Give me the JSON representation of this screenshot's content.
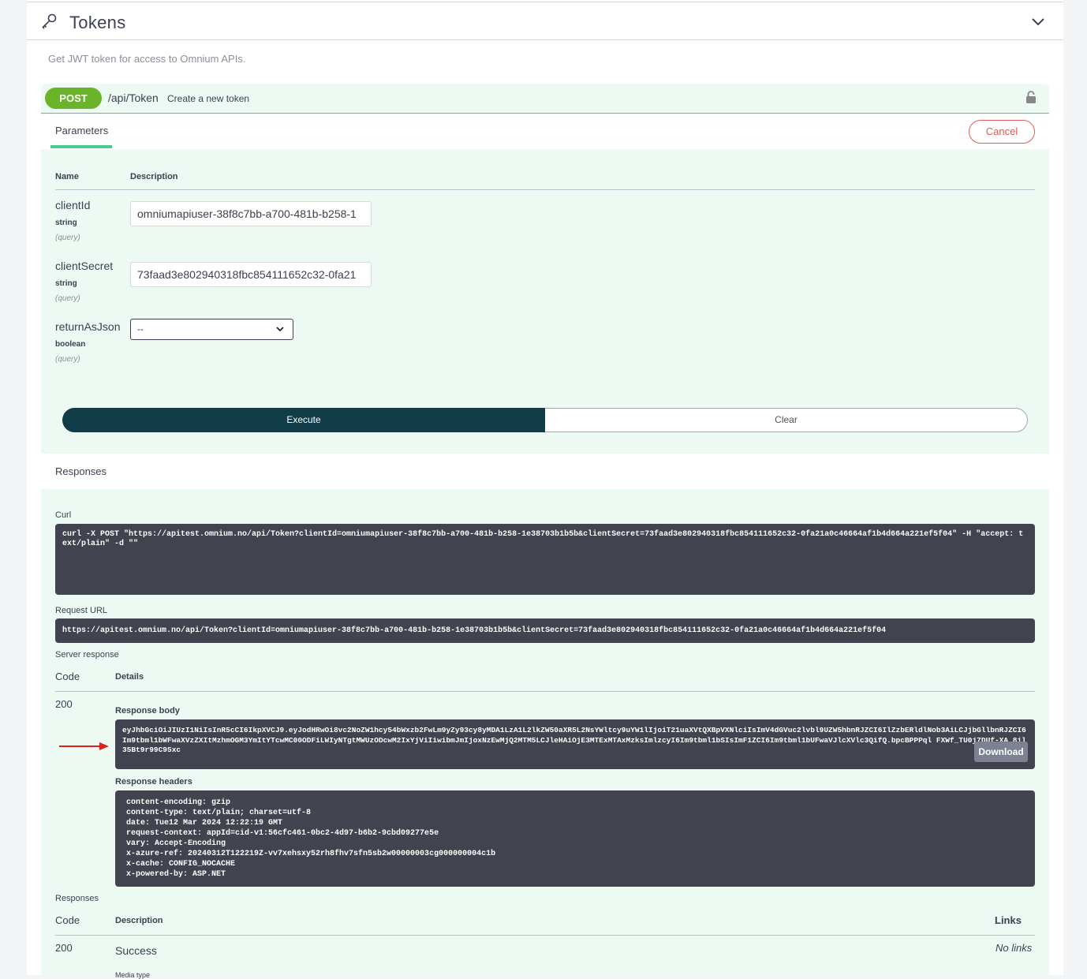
{
  "tag": {
    "title": "Tokens",
    "description": "Get JWT token for access to Omnium APIs."
  },
  "operation": {
    "method": "POST",
    "path": "/api/Token",
    "summary": "Create a new token"
  },
  "tabs": {
    "parameters": "Parameters",
    "cancel": "Cancel"
  },
  "param_headers": {
    "name": "Name",
    "description": "Description"
  },
  "params": [
    {
      "name": "clientId",
      "type": "string",
      "in": "(query)",
      "value": "omniumapiuser-38f8c7bb-a700-481b-b258-1"
    },
    {
      "name": "clientSecret",
      "type": "string",
      "in": "(query)",
      "value": "73faad3e802940318fbc854111652c32-0fa21"
    },
    {
      "name": "returnAsJson",
      "type": "boolean",
      "in": "(query)",
      "value": "--"
    }
  ],
  "buttons": {
    "execute": "Execute",
    "clear": "Clear"
  },
  "responses_title": "Responses",
  "curl": {
    "label": "Curl",
    "command": "curl -X POST \"https://apitest.omnium.no/api/Token?clientId=omniumapiuser-38f8c7bb-a700-481b-b258-1e38703b1b5b&clientSecret=73faad3e802940318fbc854111652c32-0fa21a0c46664af1b4d664a221ef5f04\" -H \"accept: text/plain\" -d \"\""
  },
  "request_url": {
    "label": "Request URL",
    "url": "https://apitest.omnium.no/api/Token?clientId=omniumapiuser-38f8c7bb-a700-481b-b258-1e38703b1b5b&clientSecret=73faad3e802940318fbc854111652c32-0fa21a0c46664af1b4d664a221ef5f04"
  },
  "server_response": {
    "label": "Server response",
    "code_header": "Code",
    "details_header": "Details",
    "code": "200",
    "body_label": "Response body",
    "body": "eyJhbGciOiJIUzI1NiIsInR5cCI6IkpXVCJ9.eyJodHRwOi8vc2NoZW1hcy54bWxzb2FwLm9yZy93cy8yMDA1LzA1L2lkZW50aXR5L2NsYWltcy9uYW1lIjoiT21uaXVtQXBpVXNlciIsImV4dGVuc2lvbl9UZW5hbnRJZCI6IlZzbERldlNob3AiLCJjbGllbnRJZCI6Im9tbml1bWFwaXVzZXItMzhmOGM3YmItYTcwMC00ODFiLWIyNTgtMWUzODcwM2IxYjViIiwibmJmIjoxNzEwMjQ2MTM5LCJleHAiOjE3MTExMTAxMzksImlzcyI6Im9tbml1bSIsImF1ZCI6Im9tbml1bUFwaVJlcXVlc3QifQ.bpcBPPPql FXWf_TU0j7DUf-XA_8il35Bt9r99C95xc",
    "download": "Download",
    "headers_label": "Response headers",
    "headers": [
      "content-encoding: gzip",
      "content-type: text/plain; charset=utf-8",
      "date: Tue12 Mar 2024 12:22:19 GMT",
      "request-context: appId=cid-v1:56cfc461-0bc2-4d97-b6b2-9cbd09277e5e",
      "vary: Accept-Encoding",
      "x-azure-ref: 20240312T122219Z-vv7xehsxy52rh8fhv7sfn5sb2w00000003cg000000004c1b",
      "x-cache: CONFIG_NOCACHE",
      "x-powered-by: ASP.NET"
    ]
  },
  "documented_responses": {
    "label": "Responses",
    "code_header": "Code",
    "description_header": "Description",
    "links_header": "Links",
    "code": "200",
    "description": "Success",
    "links": "No links",
    "media_type": "Media type"
  },
  "colors": {
    "post": "#6ab42a",
    "opblock_bg": "#edf9f3",
    "execute": "#113c4a",
    "cancel": "#e05c5c",
    "code_bg": "#41444e",
    "arrow": "#e0201b"
  }
}
